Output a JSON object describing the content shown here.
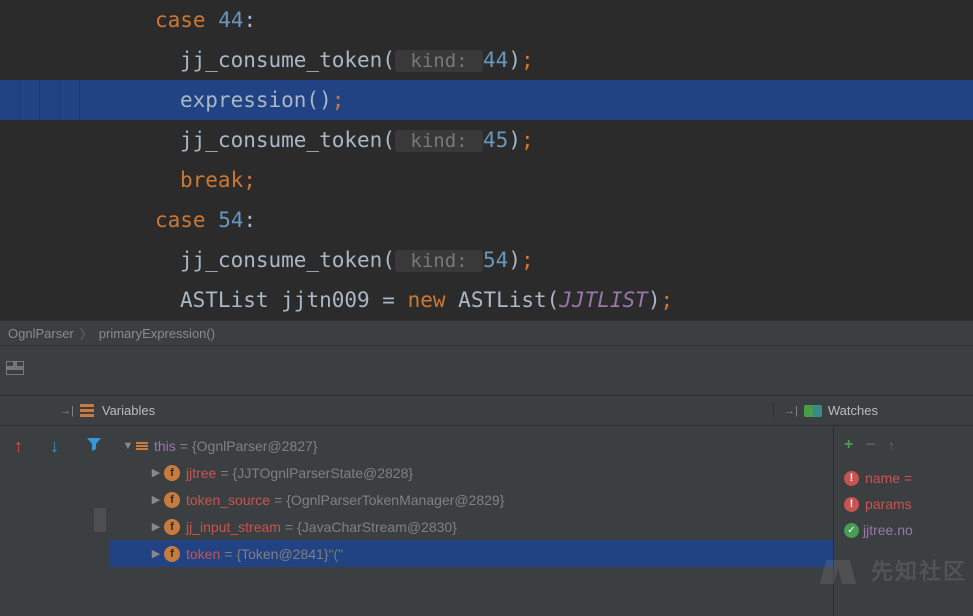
{
  "code": {
    "lines": [
      {
        "indent": 155,
        "tokens": [
          {
            "t": "kw",
            "v": "case "
          },
          {
            "t": "num",
            "v": "44"
          },
          {
            "t": "ident",
            "v": ":"
          }
        ]
      },
      {
        "indent": 180,
        "tokens": [
          {
            "t": "ident",
            "v": "jj_consume_token("
          },
          {
            "t": "hint",
            "v": " kind: "
          },
          {
            "t": "num",
            "v": "44"
          },
          {
            "t": "ident",
            "v": ")"
          },
          {
            "t": "semi",
            "v": ";"
          }
        ]
      },
      {
        "indent": 180,
        "highlight": true,
        "tokens": [
          {
            "t": "ident",
            "v": "expression()"
          },
          {
            "t": "semi",
            "v": ";"
          }
        ]
      },
      {
        "indent": 180,
        "tokens": [
          {
            "t": "ident",
            "v": "jj_consume_token("
          },
          {
            "t": "hint",
            "v": " kind: "
          },
          {
            "t": "num",
            "v": "45"
          },
          {
            "t": "ident",
            "v": ")"
          },
          {
            "t": "semi",
            "v": ";"
          }
        ]
      },
      {
        "indent": 180,
        "tokens": [
          {
            "t": "kw",
            "v": "break"
          },
          {
            "t": "semi",
            "v": ";"
          }
        ]
      },
      {
        "indent": 155,
        "tokens": [
          {
            "t": "kw",
            "v": "case "
          },
          {
            "t": "num",
            "v": "54"
          },
          {
            "t": "ident",
            "v": ":"
          }
        ]
      },
      {
        "indent": 180,
        "tokens": [
          {
            "t": "ident",
            "v": "jj_consume_token("
          },
          {
            "t": "hint",
            "v": " kind: "
          },
          {
            "t": "num",
            "v": "54"
          },
          {
            "t": "ident",
            "v": ")"
          },
          {
            "t": "semi",
            "v": ";"
          }
        ]
      },
      {
        "indent": 180,
        "tokens": [
          {
            "t": "classname",
            "v": "ASTList "
          },
          {
            "t": "ident",
            "v": "jjtn009 = "
          },
          {
            "t": "new-kw",
            "v": "new "
          },
          {
            "t": "ident",
            "v": "ASTList("
          },
          {
            "t": "italic-const",
            "v": "JJTLIST"
          },
          {
            "t": "ident",
            "v": ")"
          },
          {
            "t": "semi",
            "v": ";"
          }
        ]
      }
    ]
  },
  "breadcrumb": {
    "items": [
      "OgnlParser",
      "primaryExpression()"
    ]
  },
  "panels": {
    "variables_label": "Variables",
    "watches_label": "Watches"
  },
  "variables": {
    "root": {
      "name": "this",
      "value": "{OgnlParser@2827}"
    },
    "children": [
      {
        "name": "jjtree",
        "value": "{JJTOgnlParserState@2828}"
      },
      {
        "name": "token_source",
        "value": "{OgnlParserTokenManager@2829}"
      },
      {
        "name": "jj_input_stream",
        "value": "{JavaCharStream@2830}"
      },
      {
        "name": "token",
        "value": "{Token@2841}",
        "string": "\"(\"",
        "selected": true
      }
    ]
  },
  "watches": {
    "items": [
      {
        "err": true,
        "name": "name",
        "trail": "="
      },
      {
        "err": true,
        "name": "params",
        "trail": ""
      },
      {
        "err": false,
        "name": "jjtree.no",
        "trail": ""
      }
    ]
  },
  "watermark": "先知社区"
}
